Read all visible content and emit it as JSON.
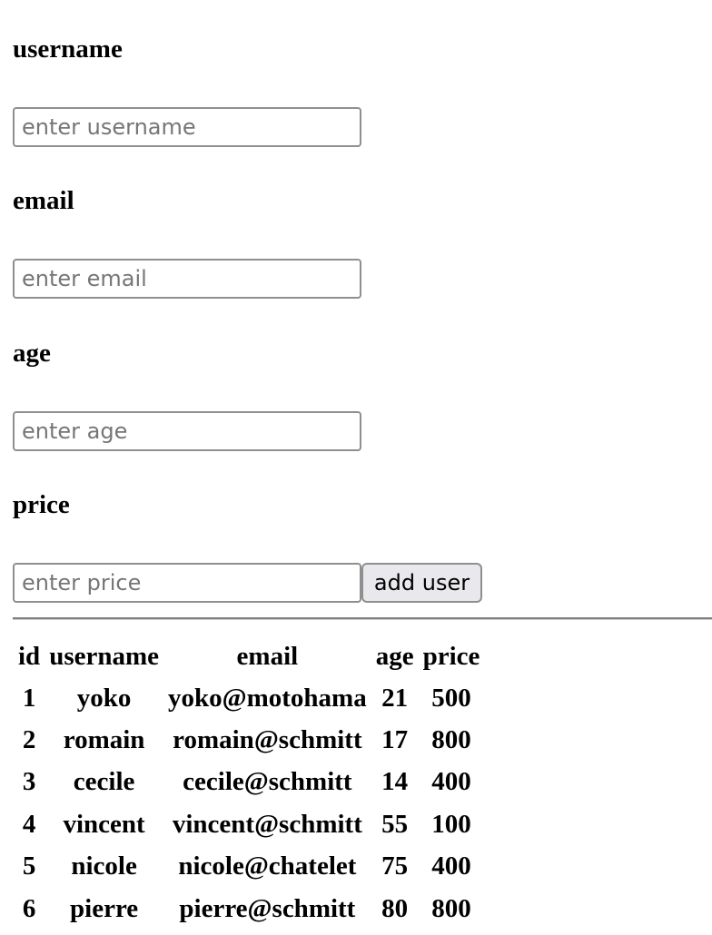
{
  "form": {
    "username_label": "username",
    "username_placeholder": "enter username",
    "email_label": "email",
    "email_placeholder": "enter email",
    "age_label": "age",
    "age_placeholder": "enter age",
    "price_label": "price",
    "price_placeholder": "enter price",
    "submit_label": "add user"
  },
  "table": {
    "headers": {
      "id": "id",
      "username": "username",
      "email": "email",
      "age": "age",
      "price": "price"
    },
    "rows": [
      {
        "id": "1",
        "username": "yoko",
        "email": "yoko@motohama",
        "age": "21",
        "price": "500"
      },
      {
        "id": "2",
        "username": "romain",
        "email": "romain@schmitt",
        "age": "17",
        "price": "800"
      },
      {
        "id": "3",
        "username": "cecile",
        "email": "cecile@schmitt",
        "age": "14",
        "price": "400"
      },
      {
        "id": "4",
        "username": "vincent",
        "email": "vincent@schmitt",
        "age": "55",
        "price": "100"
      },
      {
        "id": "5",
        "username": "nicole",
        "email": "nicole@chatelet",
        "age": "75",
        "price": "400"
      },
      {
        "id": "6",
        "username": "pierre",
        "email": "pierre@schmitt",
        "age": "80",
        "price": "800"
      }
    ]
  }
}
